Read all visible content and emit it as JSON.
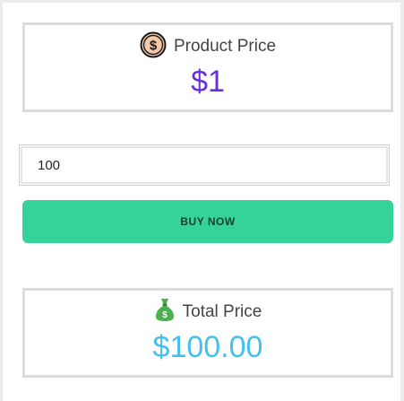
{
  "product_card": {
    "label": "Product Price",
    "value": "$1",
    "icon": "coin-dollar-icon"
  },
  "quantity_input": {
    "value": "100"
  },
  "buy_button": {
    "label": "BUY NOW",
    "color": "#35d399"
  },
  "total_card": {
    "label": "Total Price",
    "value": "$100.00",
    "icon": "money-bag-icon"
  },
  "colors": {
    "product_value": "#6a2de0",
    "total_value": "#45c0ea",
    "card_border": "#dcdcdc"
  }
}
